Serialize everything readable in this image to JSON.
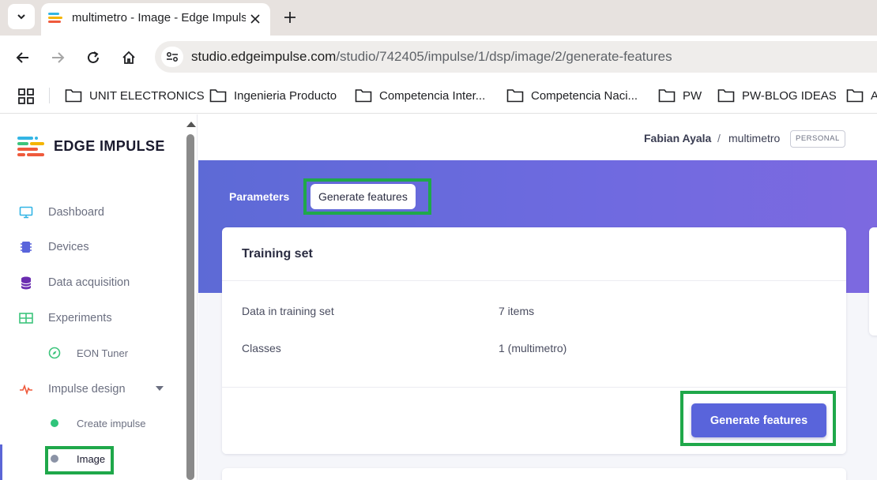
{
  "browser": {
    "tab_title": "multimetro - Image - Edge Impulse",
    "url_host": "studio.edgeimpulse.com",
    "url_path": "/studio/742405/impulse/1/dsp/image/2/generate-features",
    "bookmarks": [
      "UNIT ELECTRONICS",
      "Ingenieria Producto",
      "Competencia Inter...",
      "Competencia Naci...",
      "PW",
      "PW-BLOG IDEAS",
      "A"
    ]
  },
  "sidebar": {
    "logo_text": "EDGE IMPULSE",
    "items": [
      {
        "label": "Dashboard",
        "icon": "monitor-icon"
      },
      {
        "label": "Devices",
        "icon": "chip-icon"
      },
      {
        "label": "Data acquisition",
        "icon": "database-icon"
      },
      {
        "label": "Experiments",
        "icon": "table-icon"
      },
      {
        "label": "EON Tuner",
        "icon": "compass-icon"
      },
      {
        "label": "Impulse design",
        "icon": "pulse-icon"
      },
      {
        "label": "Create impulse",
        "icon": "green-dot-icon"
      },
      {
        "label": "Image",
        "icon": "gray-dot-icon"
      }
    ]
  },
  "header": {
    "user": "Fabian Ayala",
    "separator": "/",
    "project": "multimetro",
    "badge": "PERSONAL"
  },
  "tabs": {
    "parameters": "Parameters",
    "generate_features": "Generate features"
  },
  "training_set": {
    "title": "Training set",
    "rows": [
      {
        "label": "Data in training set",
        "value": "7 items"
      },
      {
        "label": "Classes",
        "value": "1 (multimetro)"
      }
    ],
    "button_label": "Generate features"
  },
  "colors": {
    "accent": "#5964db",
    "highlight": "#1fa84a",
    "hero": "#6a6adf"
  }
}
